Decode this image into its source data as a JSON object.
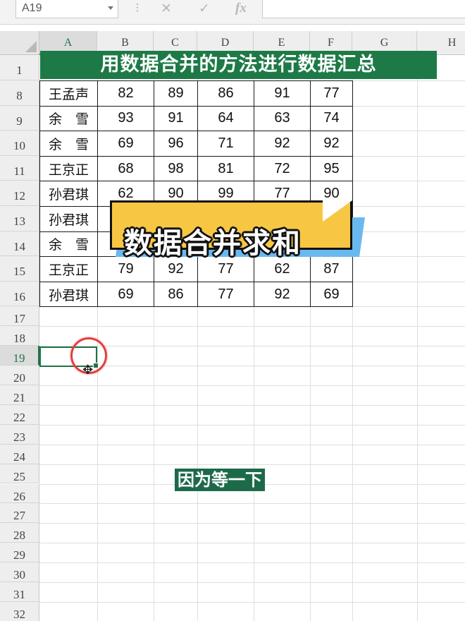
{
  "formula_bar": {
    "name_box": "A19",
    "fx_label": "fx",
    "cancel_symbol": "✕",
    "confirm_symbol": "✓",
    "formula": ""
  },
  "columns": [
    "A",
    "B",
    "C",
    "D",
    "E",
    "F",
    "G",
    "H"
  ],
  "row_numbers": [
    "1",
    "8",
    "9",
    "10",
    "11",
    "12",
    "13",
    "14",
    "15",
    "16",
    "17",
    "18",
    "19",
    "20",
    "21",
    "22",
    "23",
    "24",
    "25",
    "26",
    "27",
    "28",
    "29",
    "30",
    "31",
    "32"
  ],
  "selected_cell": "A19",
  "title": "用数据合并的方法进行数据汇总",
  "table": {
    "rows": [
      {
        "name": "王孟声",
        "values": [
          "82",
          "89",
          "86",
          "91",
          "77"
        ]
      },
      {
        "name": "余　雪",
        "values": [
          "93",
          "91",
          "64",
          "63",
          "74"
        ]
      },
      {
        "name": "余　雪",
        "values": [
          "69",
          "96",
          "71",
          "92",
          "92"
        ]
      },
      {
        "name": "王京正",
        "values": [
          "68",
          "98",
          "81",
          "72",
          "95"
        ]
      },
      {
        "name": "孙君琪",
        "values": [
          "62",
          "90",
          "99",
          "77",
          "90"
        ]
      },
      {
        "name": "孙君琪",
        "values": [
          "",
          "",
          "",
          "",
          ""
        ]
      },
      {
        "name": "余　雪",
        "values": [
          "",
          "",
          "",
          "",
          ""
        ]
      },
      {
        "name": "王京正",
        "values": [
          "79",
          "92",
          "77",
          "62",
          "87"
        ]
      },
      {
        "name": "孙君琪",
        "values": [
          "69",
          "86",
          "77",
          "92",
          "69"
        ]
      }
    ]
  },
  "banner_text": "数据合并求和",
  "caption": "因为等一下",
  "colors": {
    "excel_green": "#217346",
    "title_bg": "#1d7a47",
    "banner_yellow": "#f7c744",
    "banner_blue": "#6ab9ee",
    "circle_red": "#e0403f"
  }
}
